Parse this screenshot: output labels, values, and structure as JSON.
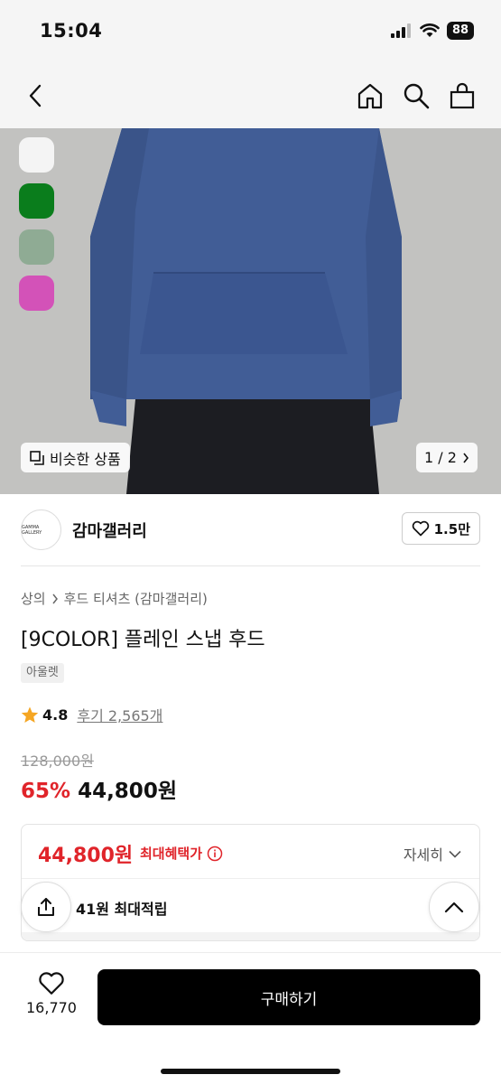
{
  "status": {
    "time": "15:04",
    "battery": "88"
  },
  "nav": {
    "back_icon": "chevron-left-icon",
    "home_icon": "home-icon",
    "search_icon": "search-icon",
    "bag_icon": "shopping-bag-icon"
  },
  "image": {
    "swatches": [
      "#f4f4f4",
      "#0a7d1c",
      "#8fab94",
      "#d352b8"
    ],
    "similar_label": "비슷한 상품",
    "page_indicator": "1 / 2"
  },
  "brand": {
    "logo_text": "GAMMA GALLERY",
    "name": "감마갤러리",
    "likes": "1.5만"
  },
  "product": {
    "breadcrumb": [
      "상의",
      "후드 티셔츠 (감마갤러리)"
    ],
    "title": "[9COLOR] 플레인 스냅 후드",
    "badge": "아울렛",
    "rating": "4.8",
    "review_text": "후기 2,565개",
    "original_price": "128,000원",
    "discount": "65%",
    "sale_price": "44,800원"
  },
  "benefit": {
    "price": "44,800원",
    "label": "최대혜택가",
    "detail_label": "자세히",
    "points_text": "41원 최대적립"
  },
  "bottom": {
    "wish_count": "16,770",
    "buy_label": "구매하기"
  },
  "colors": {
    "accent_red": "#e0242a",
    "buy_button": "#000000"
  }
}
